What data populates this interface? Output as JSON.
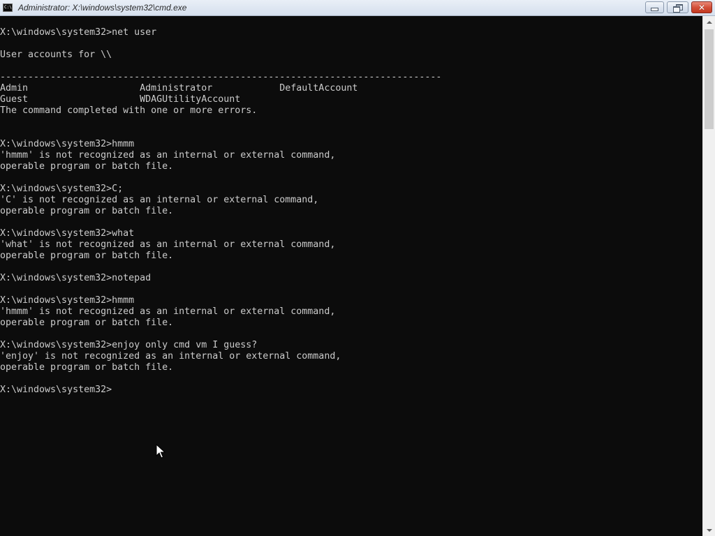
{
  "window": {
    "title": "Administrator: X:\\windows\\system32\\cmd.exe",
    "icon_text": "C:\\",
    "icon": "cmd-icon",
    "buttons": {
      "minimize": "minimize-icon",
      "maximize": "restore-icon",
      "close": "close-icon",
      "close_glyph": "✕"
    }
  },
  "colors": {
    "console_background": "#0c0c0c",
    "console_text": "#cccccc",
    "close_button": "#c2381f"
  },
  "console": {
    "lines": [
      "X:\\windows\\system32>net user",
      "",
      "User accounts for \\\\",
      "",
      "-------------------------------------------------------------------------------",
      "Admin                    Administrator            DefaultAccount",
      "Guest                    WDAGUtilityAccount",
      "The command completed with one or more errors.",
      "",
      "",
      "X:\\windows\\system32>hmmm",
      "'hmmm' is not recognized as an internal or external command,",
      "operable program or batch file.",
      "",
      "X:\\windows\\system32>C;",
      "'C' is not recognized as an internal or external command,",
      "operable program or batch file.",
      "",
      "X:\\windows\\system32>what",
      "'what' is not recognized as an internal or external command,",
      "operable program or batch file.",
      "",
      "X:\\windows\\system32>notepad",
      "",
      "X:\\windows\\system32>hmmm",
      "'hmmm' is not recognized as an internal or external command,",
      "operable program or batch file.",
      "",
      "X:\\windows\\system32>enjoy only cmd vm I guess?",
      "'enjoy' is not recognized as an internal or external command,",
      "operable program or batch file.",
      "",
      "X:\\windows\\system32>"
    ]
  },
  "scrollbar": {
    "up_icon": "scroll-up-arrow-icon",
    "down_icon": "scroll-down-arrow-icon"
  },
  "pointer": {
    "icon": "mouse-pointer-icon"
  }
}
